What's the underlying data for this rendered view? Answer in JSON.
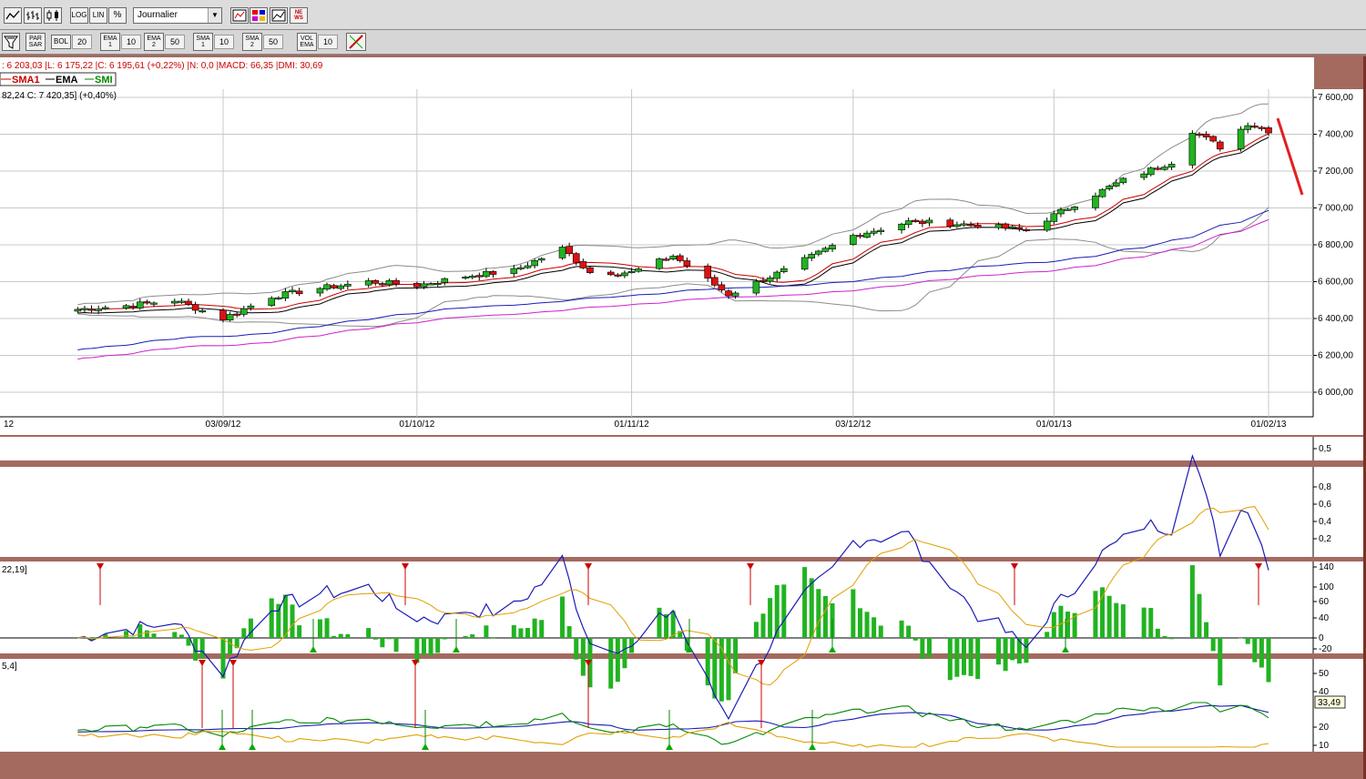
{
  "toolbar": {
    "log_label": "LOG",
    "lin_label": "LIN",
    "percent_label": "%",
    "period_selected": "Journalier",
    "par_sar_label": "PAR SAR",
    "bol_label": "BOL",
    "bol_value": "20",
    "ema1_label": "EMA 1",
    "ema1_value": "10",
    "ema2_label": "EMA 2",
    "ema2_value": "50",
    "sma1_label": "SMA 1",
    "sma1_value": "10",
    "sma2_label": "SMA 2",
    "sma2_value": "50",
    "vol_label": "VOL EMA",
    "vol_value": "10",
    "news_label": "NE WS"
  },
  "header": {
    "quote_line": ": 6 203,03 |L: 6 175,22 |C: 6 195,61 (+0,22%) |N: 0,0 |MACD: 66,35 |DMI: 30,69",
    "legend_sma1": "SMA1",
    "legend_ema": "EMA",
    "legend_smi": "SMI",
    "price_info": "82,24  C: 7 420,35] (+0,40%)"
  },
  "chart_data": {
    "type": "candlestick",
    "x_tick_labels": [
      "12",
      "03/09/12",
      "01/10/12",
      "01/11/12",
      "03/12/12",
      "01/01/13",
      "01/02/13"
    ],
    "y_tick_labels": [
      "7 600,00",
      "7 400,00",
      "7 200,00",
      "7 000,00",
      "6 800,00",
      "6 600,00",
      "6 400,00",
      "6 200,00",
      "6 000,00"
    ],
    "ylim": [
      5950,
      7650
    ],
    "close_anchors": [
      [
        "2012-08-13",
        6450
      ],
      [
        "2012-08-20",
        6470
      ],
      [
        "2012-08-27",
        6500
      ],
      [
        "2012-09-03",
        6400
      ],
      [
        "2012-09-10",
        6520
      ],
      [
        "2012-09-17",
        6565
      ],
      [
        "2012-09-24",
        6600
      ],
      [
        "2012-10-01",
        6580
      ],
      [
        "2012-10-08",
        6630
      ],
      [
        "2012-10-15",
        6660
      ],
      [
        "2012-10-22",
        6780
      ],
      [
        "2012-10-26",
        6650
      ],
      [
        "2012-11-01",
        6650
      ],
      [
        "2012-11-07",
        6740
      ],
      [
        "2012-11-15",
        6530
      ],
      [
        "2012-11-23",
        6660
      ],
      [
        "2012-12-03",
        6850
      ],
      [
        "2012-12-11",
        6925
      ],
      [
        "2012-12-20",
        6910
      ],
      [
        "2012-12-28",
        6880
      ],
      [
        "2013-01-04",
        7020
      ],
      [
        "2013-01-11",
        7150
      ],
      [
        "2013-01-18",
        7250
      ],
      [
        "2013-01-21",
        7420
      ],
      [
        "2013-01-25",
        7330
      ],
      [
        "2013-01-29",
        7460
      ],
      [
        "2013-02-01",
        7420
      ]
    ],
    "panel_2_ticks": [
      "0,5"
    ],
    "panel_3_ticks": [
      "0,8",
      "0,6",
      "0,4",
      "0,2"
    ],
    "macd_label": "22,19]",
    "macd_ticks": [
      "140",
      "100",
      "60",
      "40",
      "0",
      "-20"
    ],
    "dmi_label": "5,4]",
    "dmi_ticks": [
      "50",
      "40",
      "20",
      "10"
    ],
    "dmi_current": "33,49"
  }
}
